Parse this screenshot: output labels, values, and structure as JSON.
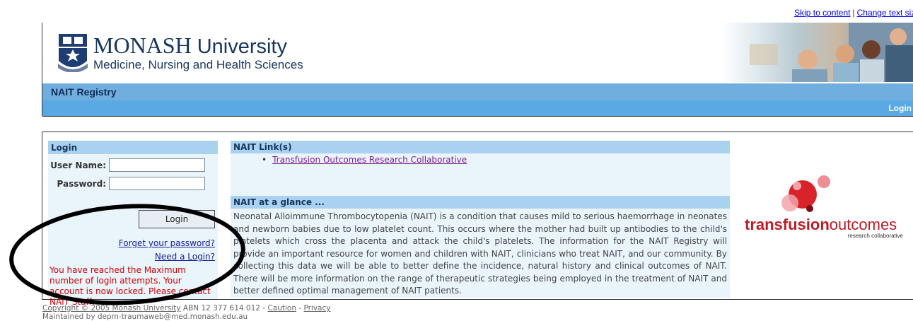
{
  "top_links": {
    "skip": "Skip to content",
    "separator": "|",
    "text_size": "Change text size"
  },
  "brand": {
    "name_bold": "MONASH",
    "name_rest": "University",
    "faculty": "Medicine, Nursing and Health Sciences"
  },
  "nav": {
    "title": "NAIT Registry",
    "login": "Login"
  },
  "login_panel": {
    "heading": "Login",
    "username_label": "User Name:",
    "username_value": "",
    "password_label": "Password:",
    "password_value": "",
    "button": "Login",
    "forgot": "Forget your password?",
    "need": "Need a Login?",
    "error": "You have reached the Maximum number of login attempts. Your account is now locked. Please contact NAIT Staff."
  },
  "links_section": {
    "heading": "NAIT Link(s)",
    "items": [
      "Transfusion Outcomes Research Collaborative"
    ]
  },
  "glance_section": {
    "heading": "NAIT at a glance ...",
    "body": "Neonatal Alloimmune Thrombocytopenia (NAIT) is a condition that causes mild to serious haemorrhage in neonates and newborn babies due to low platelet count. This occurs where the mother had built up antibodies to the child's platelets which cross the placenta and attack the child's platelets. The information for the NAIT Registry will provide an important resource for women and children with NAIT, clinicians who treat NAIT, and our community. By collecting this data we will be able to better define the incidence, natural history and clinical outcomes of NAIT. There will be more information on the range of therapeutic strategies being employed in the treatment of NAIT and better defined optimal management of NAIT patients."
  },
  "partner_logo": {
    "word_bold": "transfusion",
    "word_rest": "outcomes",
    "tagline": "research collaborative",
    "color": "#c01b24"
  },
  "footer": {
    "copyright": "Copyright © 2005 Monash University",
    "abn": " ABN 12 377 614 012 - ",
    "caution": "Caution",
    "dash": " - ",
    "privacy": "Privacy",
    "maintained": "Maintained by depm-traumaweb@med.monash.edu.au"
  }
}
